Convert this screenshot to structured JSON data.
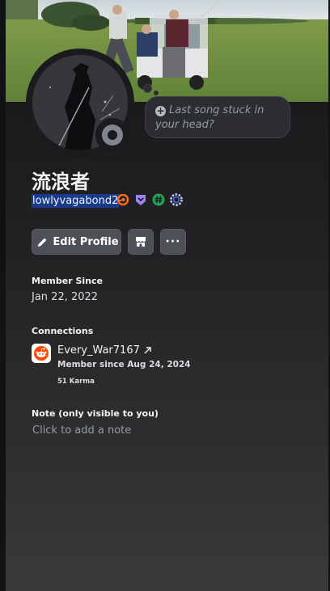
{
  "profile": {
    "display_name": "流浪者",
    "username": "lowlyvagabond2",
    "status_placeholder": "Last song stuck in your head?"
  },
  "badges": [
    "nitro-boost-icon",
    "hypesquad-icon",
    "active-developer-icon",
    "quest-icon"
  ],
  "actions": {
    "edit_profile": "Edit Profile",
    "more": "···"
  },
  "member_since": {
    "heading": "Member Since",
    "date": "Jan 22, 2022"
  },
  "connections": {
    "heading": "Connections",
    "items": [
      {
        "service_icon": "reddit-icon",
        "name": "Every_War7167",
        "member_since": "Member since Aug 24, 2024",
        "karma": "51 Karma"
      }
    ]
  },
  "note": {
    "heading": "Note (only visible to you)",
    "placeholder": "Click to add a note"
  },
  "colors": {
    "background": "#1e1f22",
    "button": "#4e5058",
    "selection": "#1a3a8c",
    "reddit": "#ff4500"
  }
}
